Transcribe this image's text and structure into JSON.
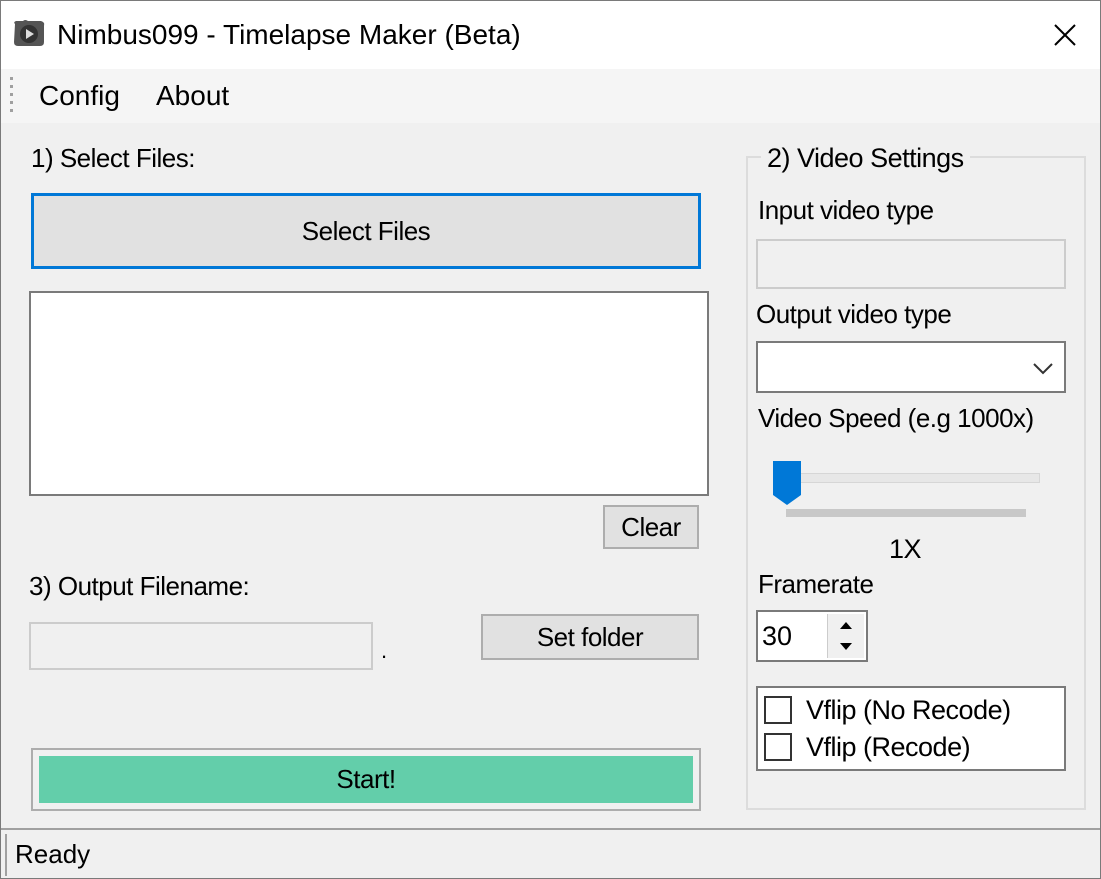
{
  "window": {
    "title": "Nimbus099 - Timelapse Maker (Beta)"
  },
  "menu": {
    "items": [
      "Config",
      "About"
    ]
  },
  "files_section": {
    "label": "1) Select Files:",
    "select_button": "Select Files",
    "clear_button": "Clear"
  },
  "output_section": {
    "label": "3) Output Filename:",
    "filename_value": "",
    "extension_separator": ".",
    "set_folder_button": "Set folder"
  },
  "video_settings": {
    "group_title": "2) Video Settings",
    "input_type_label": "Input video type",
    "input_type_value": "",
    "output_type_label": "Output video type",
    "output_type_value": "",
    "speed_label": "Video Speed (e.g 1000x)",
    "speed_slider_fraction": 0.0,
    "speed_value": "1X",
    "framerate_label": "Framerate",
    "framerate_value": "30",
    "options": [
      {
        "label": "Vflip (No Recode)",
        "checked": false
      },
      {
        "label": "Vflip (Recode)",
        "checked": false
      }
    ]
  },
  "start_button": "Start!",
  "status": "Ready",
  "colors": {
    "start_fill": "#63ceaa",
    "focus_border": "#0078d7",
    "slider_thumb": "#0078d7"
  }
}
